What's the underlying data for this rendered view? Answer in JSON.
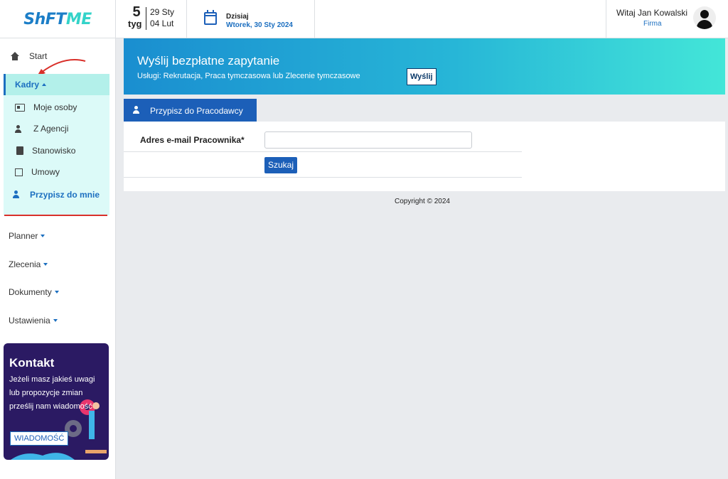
{
  "header": {
    "logo_left": "ShFT",
    "logo_right": "ME",
    "week_number": "5",
    "week_label": "tyg",
    "week_start": "29 Sty",
    "week_end": "04 Lut",
    "today_label": "Dzisiaj",
    "today_date": "Wtorek, 30 Sty 2024",
    "greeting": "Witaj Jan Kowalski",
    "company": "Firma"
  },
  "sidebar": {
    "start": "Start",
    "kadry": "Kadry",
    "kadry_items": [
      "Moje osoby",
      "Z Agencji",
      "Stanowisko",
      "Umowy"
    ],
    "assign": "Przypisz do mnie",
    "planner": "Planner",
    "zlecenia": "Zlecenia",
    "dokumenty": "Dokumenty",
    "ustawienia": "Ustawienia",
    "contact": {
      "title": "Kontakt",
      "text": "Jeżeli masz jakieś uwagi lub propozycje zmian prześlij nam wiadomość",
      "button": "WIADOMOŚĆ"
    }
  },
  "banner": {
    "title": "Wyślij bezpłatne zapytanie",
    "subtitle": "Usługi: Rekrutacja, Praca tymczasowa lub Zlecenie tymczasowe",
    "button": "Wyślij"
  },
  "form": {
    "tab_label": "Przypisz do Pracodawcy",
    "email_label": "Adres e-mail Pracownika*",
    "email_value": "",
    "search_button": "Szukaj"
  },
  "footer": {
    "copyright": "Copyright © 2024"
  },
  "colors": {
    "primary": "#1c5fb8",
    "accent": "#34d3c9",
    "annotation": "#d9302a"
  }
}
